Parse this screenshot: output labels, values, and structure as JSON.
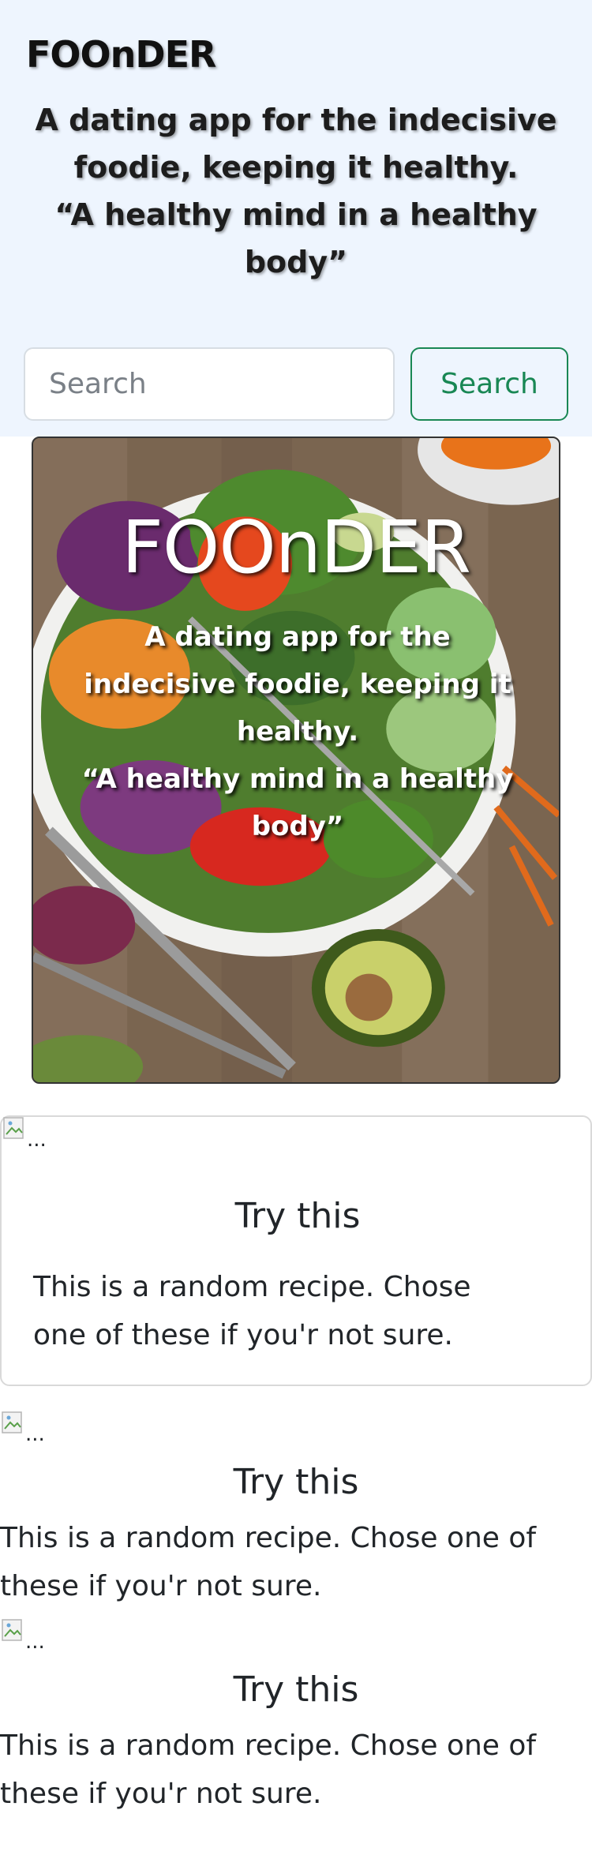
{
  "header": {
    "brand": "FOOnDER",
    "tagline_line1": "A dating app for the indecisive",
    "tagline_line2": "foodie, keeping it healthy.",
    "tagline_line3": "“A healthy mind in a healthy",
    "tagline_line4": "body”",
    "search_placeholder": "Search",
    "search_button_label": "Search",
    "accent_color": "#198754",
    "background_color": "#eef5fe"
  },
  "hero": {
    "title": "FOOnDER",
    "tagline_line1": "A dating app for the",
    "tagline_line2": "indecisive foodie, keeping it",
    "tagline_line3": "healthy.",
    "tagline_line4": "“A healthy mind in a healthy",
    "tagline_line5": "body”",
    "image_icon": "salad-bowl-photo"
  },
  "recipes": [
    {
      "image_alt": "...",
      "title": "Try this",
      "text_line1": "This is a random recipe. Chose",
      "text_line2": "one of these if you'r not sure."
    },
    {
      "image_alt": "...",
      "title": "Try this",
      "text_line1": "This is a random recipe. Chose one of",
      "text_line2": "these if you'r not sure."
    },
    {
      "image_alt": "...",
      "title": "Try this",
      "text_line1": "This is a random recipe. Chose one of",
      "text_line2": "these if you'r not sure."
    }
  ]
}
